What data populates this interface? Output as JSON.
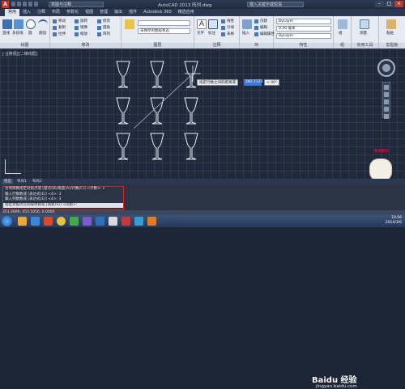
{
  "titlebar": {
    "logo": "A",
    "workspace": "草图与注释",
    "title": "AutoCAD 2013    阵列.dwg",
    "search_placeholder": "键入关键字或短语",
    "minimize": "–",
    "maximize": "□",
    "close": "×"
  },
  "tabs": [
    "常用",
    "插入",
    "注释",
    "布局",
    "参数化",
    "视图",
    "管理",
    "输出",
    "插件",
    "Autodesk 360",
    "精选应用"
  ],
  "ribbon": {
    "draw": {
      "label": "绘图",
      "tools": [
        "直线",
        "多段线",
        "圆",
        "圆弧"
      ]
    },
    "modify": {
      "label": "修改",
      "rows": [
        "移动",
        "复制",
        "拉伸",
        "旋转",
        "镜像",
        "缩放",
        "修剪",
        "圆角",
        "阵列"
      ]
    },
    "layers": {
      "label": "图层",
      "dropdown": "未保存的图层状态"
    },
    "annotation": {
      "label": "注释",
      "tools": [
        "文字",
        "标注"
      ],
      "rows": [
        "线性",
        "引线",
        "表格"
      ]
    },
    "block": {
      "label": "块",
      "tools": [
        "插入"
      ],
      "rows": [
        "创建",
        "编辑",
        "编辑属性"
      ]
    },
    "properties": {
      "label": "特性",
      "color": "ByLayer",
      "lineweight": "0.30 毫米",
      "linetype": "ByLayer"
    },
    "groups": {
      "label": "组",
      "tools": [
        "组"
      ]
    },
    "utilities": {
      "label": "实用工具",
      "tools": [
        "测量"
      ]
    },
    "clipboard": {
      "label": "剪贴板",
      "tools": [
        "粘贴"
      ]
    }
  },
  "viewport": {
    "label": "[-][俯视][二维线框]",
    "tooltip": "指定行数之间的距离或",
    "input_value": "282.1123",
    "angle": "< 40°"
  },
  "layout_tabs": [
    "模型",
    "布局1",
    "布局2"
  ],
  "command": {
    "lines": [
      "为项目数指定对角点或 [基点(B)/角度(A)/计数(C)] <计数>: c",
      "输入行数数或 [表达式(E)] <4>: 3",
      "输入列数数或 [表达式(E)] <4>: 3",
      "指定对角点以间隔项目或 [间距(S)] <间距>:"
    ]
  },
  "watermark": {
    "main": "Baidu 经验",
    "sub": "jingyan.baidu.com",
    "mascot_caption": "我来教你"
  },
  "status": {
    "coords": "351.2696, 453.5056, 0.0000"
  },
  "clock": {
    "time": "10:56",
    "date": "2014/3/6"
  },
  "colors": {
    "accent": "#3a78d8",
    "highlight_border": "#e0201c",
    "background": "#212a3a"
  }
}
